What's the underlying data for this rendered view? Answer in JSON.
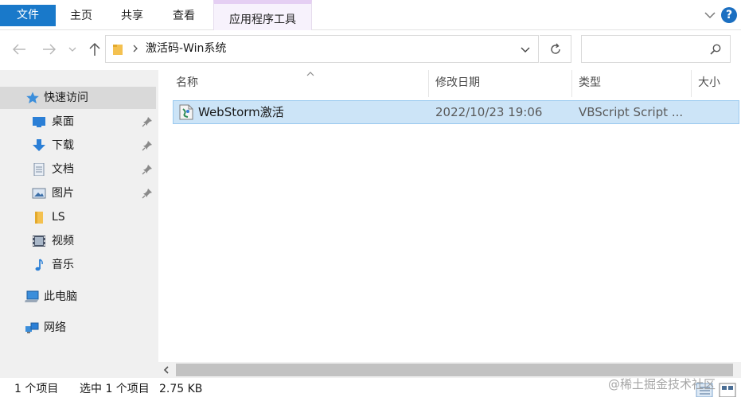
{
  "ribbon": {
    "tabs": {
      "file": "文件",
      "home": "主页",
      "share": "共享",
      "view": "查看",
      "app_tools": "应用程序工具"
    },
    "help_label": "?"
  },
  "address": {
    "path": "激活码-Win系统",
    "search_placeholder": ""
  },
  "navigation": {
    "quick_access": "快速访问",
    "items": [
      {
        "label": "桌面",
        "icon": "desktop-icon",
        "pinned": true
      },
      {
        "label": "下载",
        "icon": "download-icon",
        "pinned": true
      },
      {
        "label": "文档",
        "icon": "document-icon",
        "pinned": true
      },
      {
        "label": "图片",
        "icon": "pictures-icon",
        "pinned": true
      },
      {
        "label": "LS",
        "icon": "folder-icon",
        "pinned": false
      },
      {
        "label": "视频",
        "icon": "video-icon",
        "pinned": false
      },
      {
        "label": "音乐",
        "icon": "music-icon",
        "pinned": false
      }
    ],
    "this_pc": "此电脑",
    "network": "网络"
  },
  "columns": {
    "name": "名称",
    "date": "修改日期",
    "type": "类型",
    "size": "大小"
  },
  "files": [
    {
      "name": "WebStorm激活",
      "date": "2022/10/23 19:06",
      "type": "VBScript Script ...",
      "icon": "vbscript-file-icon",
      "selected": true
    }
  ],
  "status": {
    "count": "1 个项目",
    "selected": "选中 1 个项目",
    "size": "2.75 KB"
  },
  "watermark": "@稀土掘金技术社区",
  "colors": {
    "accent": "#1979ca",
    "selection_bg": "#cce4f7",
    "selection_border": "#99c9ef",
    "context_tab": "#e5cff3"
  }
}
